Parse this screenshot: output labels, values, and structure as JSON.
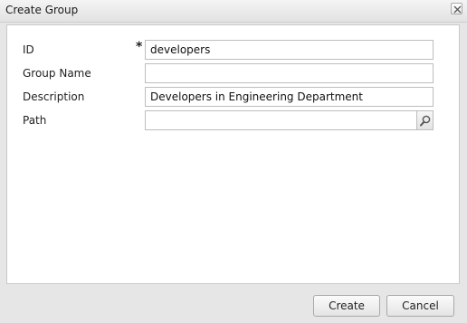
{
  "dialog": {
    "title": "Create Group",
    "close_icon": "close-icon"
  },
  "form": {
    "id_label": "ID",
    "id_required_marker": "*",
    "id_value": "developers",
    "group_name_label": "Group Name",
    "group_name_value": "",
    "description_label": "Description",
    "description_value": "Developers in Engineering Department",
    "path_label": "Path",
    "path_value": "",
    "path_search_icon": "search-icon"
  },
  "buttons": {
    "create_label": "Create",
    "cancel_label": "Cancel"
  }
}
